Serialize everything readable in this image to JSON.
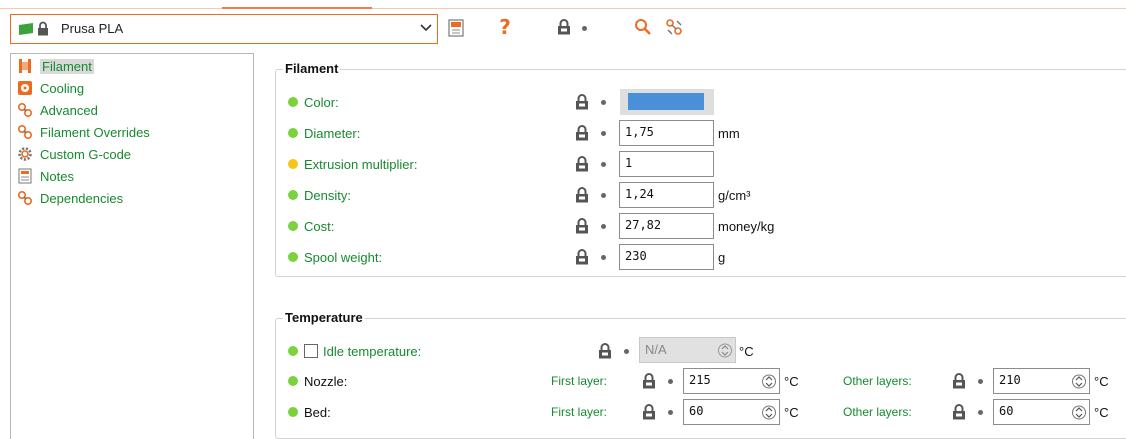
{
  "toolbar": {
    "preset_name": "Prusa PLA",
    "icons": [
      "flag-icon",
      "lock-icon",
      "dropdown-arrow-icon",
      "save-icon",
      "help-icon",
      "lock-icon",
      "search-icon",
      "compare-icon"
    ],
    "help_label": "?"
  },
  "sidebar": {
    "items": [
      {
        "label": "Filament",
        "icon": "filament-icon",
        "selected": true
      },
      {
        "label": "Cooling",
        "icon": "cooling-icon"
      },
      {
        "label": "Advanced",
        "icon": "wrench-icon"
      },
      {
        "label": "Filament Overrides",
        "icon": "wrench-icon"
      },
      {
        "label": "Custom G-code",
        "icon": "gear-icon"
      },
      {
        "label": "Notes",
        "icon": "notes-icon"
      },
      {
        "label": "Dependencies",
        "icon": "wrench-icon"
      }
    ]
  },
  "filament": {
    "title": "Filament",
    "color_label": "Color:",
    "color_value": "#4a90d9",
    "diameter_label": "Diameter:",
    "diameter_value": "1,75",
    "diameter_unit": "mm",
    "extrusion_label": "Extrusion multiplier:",
    "extrusion_value": "1",
    "density_label": "Density:",
    "density_value": "1,24",
    "density_unit": "g/cm³",
    "cost_label": "Cost:",
    "cost_value": "27,82",
    "cost_unit": "money/kg",
    "spool_label": "Spool weight:",
    "spool_value": "230",
    "spool_unit": "g"
  },
  "temperature": {
    "title": "Temperature",
    "idle_label": "Idle temperature:",
    "idle_value": "N/A",
    "unit_c": "°C",
    "nozzle_label": "Nozzle:",
    "bed_label": "Bed:",
    "first_layer_label": "First layer:",
    "other_layers_label": "Other layers:",
    "nozzle_first": "215",
    "nozzle_other": "210",
    "bed_first": "60",
    "bed_other": "60"
  },
  "colors": {
    "accent": "#ed6b21",
    "label_green": "#168a2f",
    "dot_green": "#7bd23c",
    "dot_yellow": "#f5c518"
  }
}
